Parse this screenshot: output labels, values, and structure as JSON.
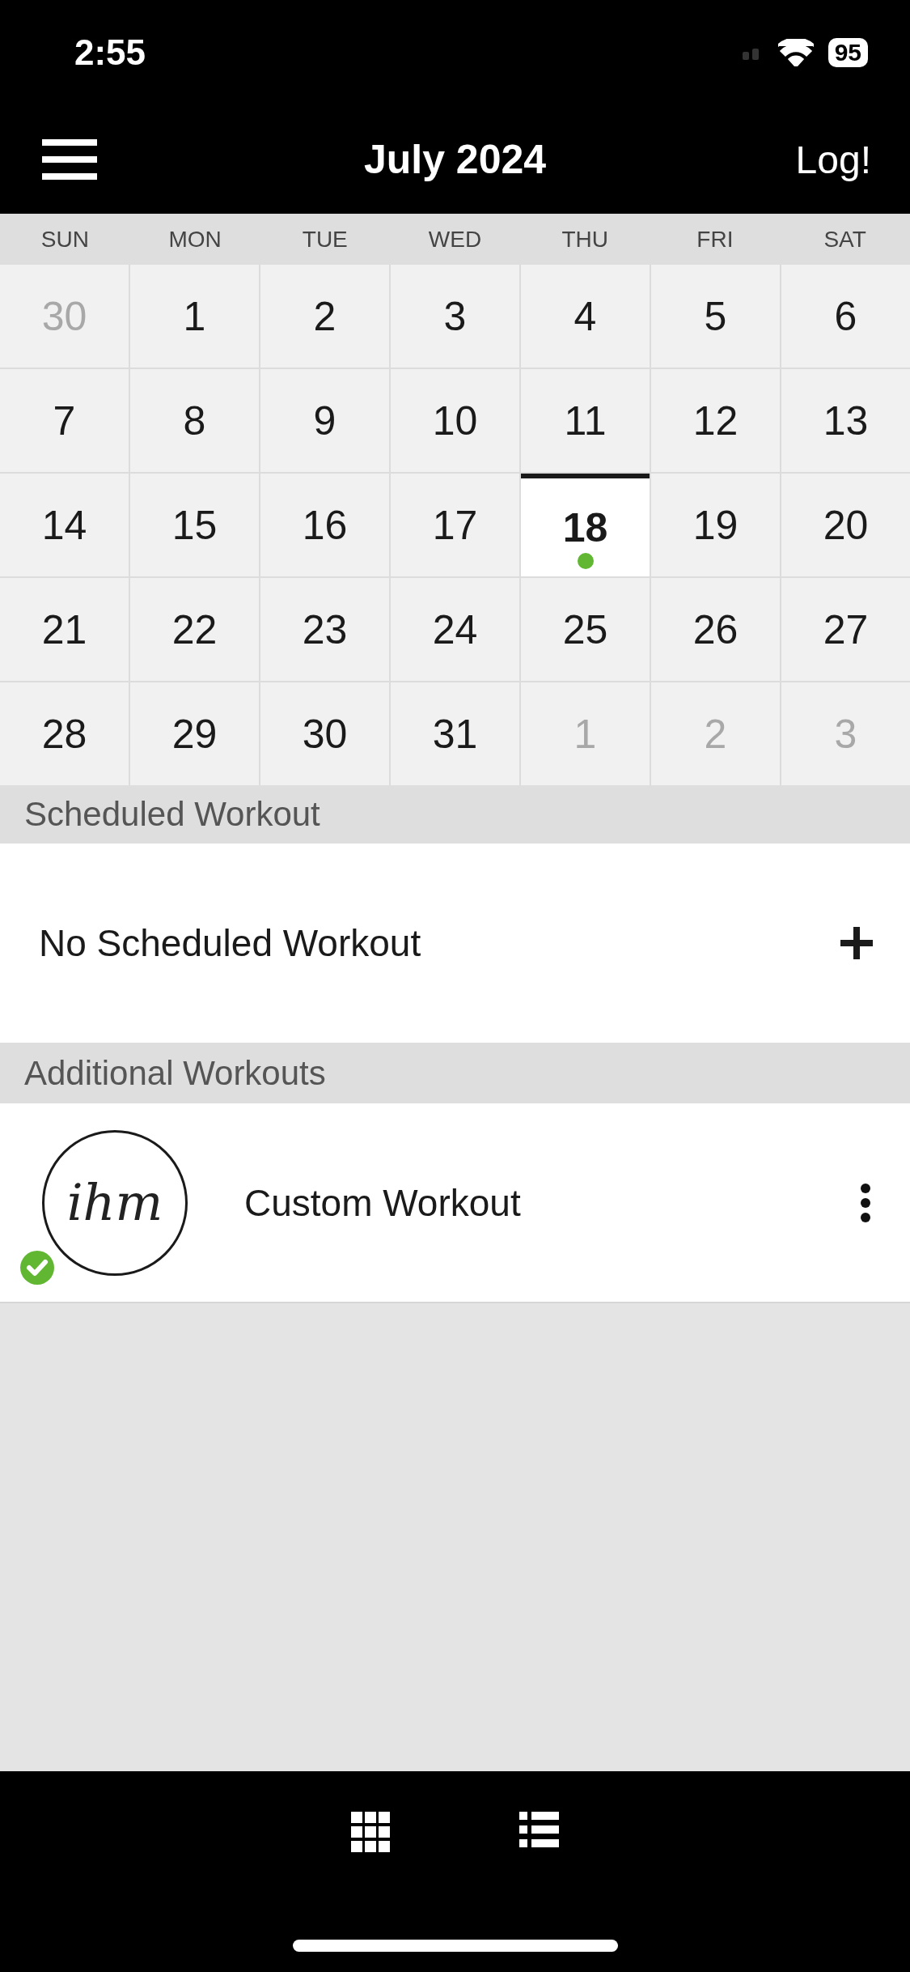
{
  "status_bar": {
    "time": "2:55",
    "battery": "95"
  },
  "nav": {
    "title": "July 2024",
    "action": "Log!"
  },
  "calendar": {
    "weekdays": [
      "SUN",
      "MON",
      "TUE",
      "WED",
      "THU",
      "FRI",
      "SAT"
    ],
    "days": [
      {
        "label": "30",
        "muted": true,
        "selected": false,
        "has_entry": false
      },
      {
        "label": "1",
        "muted": false,
        "selected": false,
        "has_entry": false
      },
      {
        "label": "2",
        "muted": false,
        "selected": false,
        "has_entry": false
      },
      {
        "label": "3",
        "muted": false,
        "selected": false,
        "has_entry": false
      },
      {
        "label": "4",
        "muted": false,
        "selected": false,
        "has_entry": false
      },
      {
        "label": "5",
        "muted": false,
        "selected": false,
        "has_entry": false
      },
      {
        "label": "6",
        "muted": false,
        "selected": false,
        "has_entry": false
      },
      {
        "label": "7",
        "muted": false,
        "selected": false,
        "has_entry": false
      },
      {
        "label": "8",
        "muted": false,
        "selected": false,
        "has_entry": false
      },
      {
        "label": "9",
        "muted": false,
        "selected": false,
        "has_entry": false
      },
      {
        "label": "10",
        "muted": false,
        "selected": false,
        "has_entry": false
      },
      {
        "label": "11",
        "muted": false,
        "selected": false,
        "has_entry": false
      },
      {
        "label": "12",
        "muted": false,
        "selected": false,
        "has_entry": false
      },
      {
        "label": "13",
        "muted": false,
        "selected": false,
        "has_entry": false
      },
      {
        "label": "14",
        "muted": false,
        "selected": false,
        "has_entry": false
      },
      {
        "label": "15",
        "muted": false,
        "selected": false,
        "has_entry": false
      },
      {
        "label": "16",
        "muted": false,
        "selected": false,
        "has_entry": false
      },
      {
        "label": "17",
        "muted": false,
        "selected": false,
        "has_entry": false
      },
      {
        "label": "18",
        "muted": false,
        "selected": true,
        "has_entry": true
      },
      {
        "label": "19",
        "muted": false,
        "selected": false,
        "has_entry": false
      },
      {
        "label": "20",
        "muted": false,
        "selected": false,
        "has_entry": false
      },
      {
        "label": "21",
        "muted": false,
        "selected": false,
        "has_entry": false
      },
      {
        "label": "22",
        "muted": false,
        "selected": false,
        "has_entry": false
      },
      {
        "label": "23",
        "muted": false,
        "selected": false,
        "has_entry": false
      },
      {
        "label": "24",
        "muted": false,
        "selected": false,
        "has_entry": false
      },
      {
        "label": "25",
        "muted": false,
        "selected": false,
        "has_entry": false
      },
      {
        "label": "26",
        "muted": false,
        "selected": false,
        "has_entry": false
      },
      {
        "label": "27",
        "muted": false,
        "selected": false,
        "has_entry": false
      },
      {
        "label": "28",
        "muted": false,
        "selected": false,
        "has_entry": false
      },
      {
        "label": "29",
        "muted": false,
        "selected": false,
        "has_entry": false
      },
      {
        "label": "30",
        "muted": false,
        "selected": false,
        "has_entry": false
      },
      {
        "label": "31",
        "muted": false,
        "selected": false,
        "has_entry": false
      },
      {
        "label": "1",
        "muted": true,
        "selected": false,
        "has_entry": false
      },
      {
        "label": "2",
        "muted": true,
        "selected": false,
        "has_entry": false
      },
      {
        "label": "3",
        "muted": true,
        "selected": false,
        "has_entry": false
      }
    ]
  },
  "scheduled": {
    "heading": "Scheduled Workout",
    "empty_text": "No Scheduled Workout"
  },
  "additional": {
    "heading": "Additional Workouts",
    "items": [
      {
        "logo_text": "ihm",
        "name": "Custom Workout",
        "completed": true
      }
    ]
  }
}
